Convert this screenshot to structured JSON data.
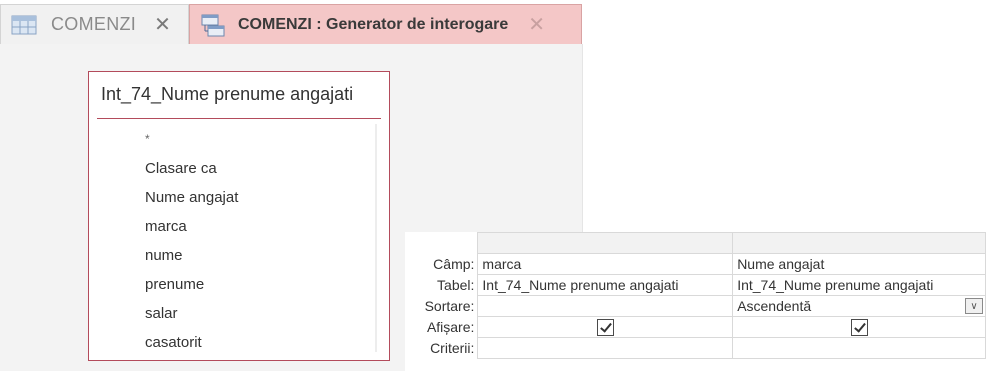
{
  "tabs": [
    {
      "label": "COMENZI",
      "close": "✕"
    },
    {
      "label": "COMENZI : Generator de interogare",
      "close": "✕"
    }
  ],
  "field_list": {
    "title": "Int_74_Nume prenume angajati",
    "fields": [
      "*",
      "Clasare ca",
      "Nume angajat",
      "marca",
      "nume",
      "prenume",
      "salar",
      "casatorit"
    ]
  },
  "grid": {
    "row_labels": {
      "camp": "Câmp:",
      "tabel": "Tabel:",
      "sortare": "Sortare:",
      "afisare": "Afișare:",
      "criterii": "Criterii:"
    },
    "columns": [
      {
        "camp": "marca",
        "tabel": "Int_74_Nume prenume angajati",
        "sortare": "",
        "afisare": true
      },
      {
        "camp": "Nume angajat",
        "tabel": "Int_74_Nume prenume angajati",
        "sortare": "Ascendentă",
        "afisare": true
      }
    ],
    "dropdown_glyph": "∨"
  },
  "colors": {
    "active_tab_bg": "#f4c7c7",
    "field_list_border": "#b34b5b"
  }
}
